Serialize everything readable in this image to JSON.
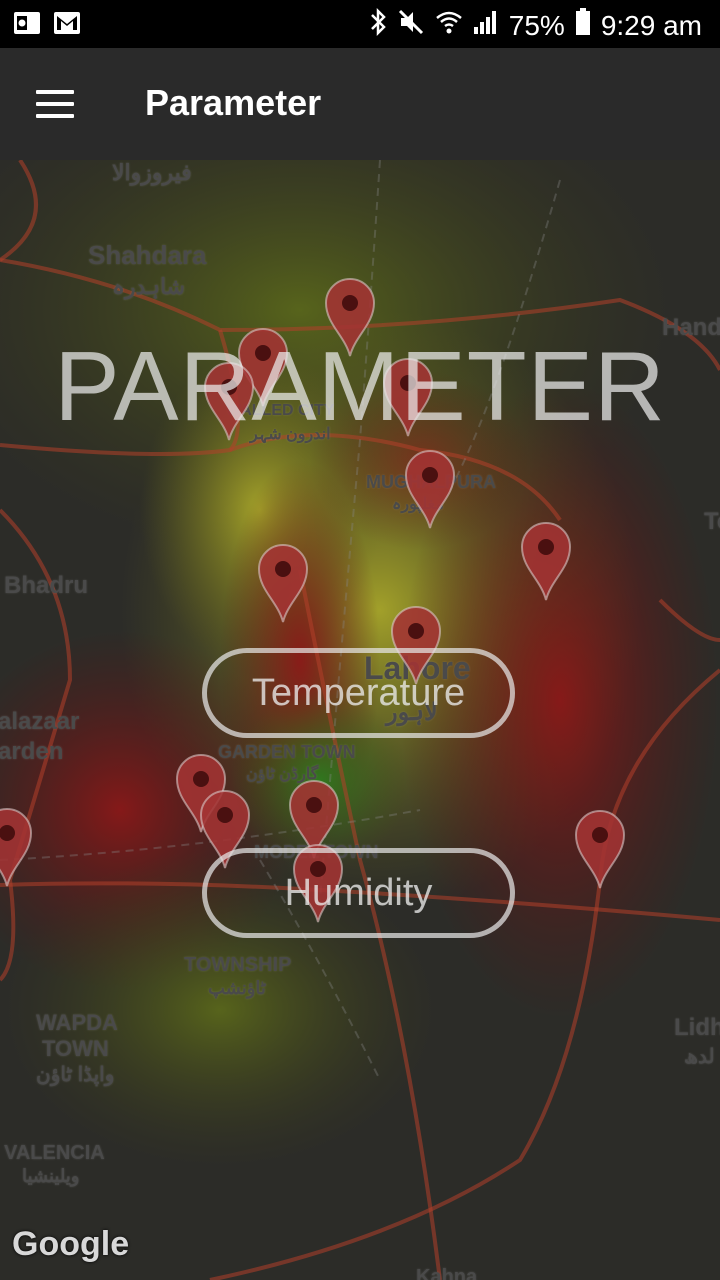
{
  "status_bar": {
    "battery_percent": "75%",
    "time": "9:29 am",
    "icons": [
      "outlook-icon",
      "gmail-icon",
      "bluetooth-icon",
      "mute-icon",
      "wifi-icon",
      "signal-icon",
      "battery-icon"
    ]
  },
  "app_bar": {
    "title": "Parameter",
    "menu_icon": "menu-icon"
  },
  "overlay": {
    "heading": "PARAMETER",
    "buttons": [
      "Temperature",
      "Humidity"
    ]
  },
  "map": {
    "labels": {
      "ferozwala_ur": "فیروزوالا",
      "shahdara": "Shahdara",
      "shahdara_ur": "شاہدرہ",
      "hand": "Hand",
      "walled_city": "WALLED CITY",
      "walled_city_ur": "اندرون شہر",
      "mughalpura": "MUGHALPURA",
      "mughalpura_ur": "مغلپورہ",
      "bhadru": "Bhadru",
      "lahore": "Lahore",
      "lahore_ur": "لاہور",
      "garden_town": "GARDEN TOWN",
      "garden_town_ur": "گارڈن ٹاؤن",
      "model_town": "MODEL TOWN",
      "township": "TOWNSHIP",
      "township_ur": "ٹاؤنشپ",
      "wapda": "WAPDA",
      "town": "TOWN",
      "wapda_ur": "واپڈا ٹاؤن",
      "valencia": "VALENCIA",
      "valencia_ur": "ویلینشیا",
      "lidher": "Lidh",
      "lidher_ur": "لدھ",
      "kahna": "Kahna",
      "te": "Te",
      "azaar": "alazaar",
      "arden": "arden"
    },
    "attribution": "Google",
    "pin_color": "#a33333"
  }
}
